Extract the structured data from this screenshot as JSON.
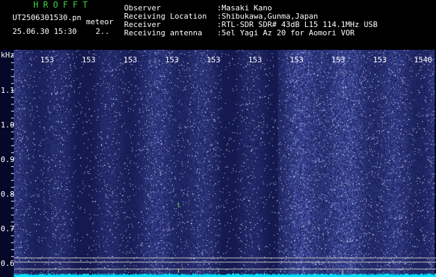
{
  "header": {
    "app_title": "HROFFT",
    "file_name": "UT2506301530.pn",
    "meteor_label": "meteor",
    "date_time": "25.06.30 15:30",
    "count_value": "2.."
  },
  "info": {
    "observer_key": "Observer",
    "observer_val": ":Masaki Kano",
    "location_key": "Receiving Location",
    "location_val": ":Shibukawa,Gunma,Japan",
    "receiver_key": "Receiver",
    "receiver_val": ":RTL-SDR SDR# 43dB L15 114.1MHz USB",
    "antenna_key": "Receiving antenna",
    "antenna_val": ":5el Yagi Az 20 for Aomori VOR"
  },
  "axis": {
    "y_unit": "kHz",
    "y_ticks": [
      "1.1",
      "1.0",
      "0.9",
      "0.8",
      "0.7",
      "0.6"
    ],
    "x_ticks": [
      "153",
      "153",
      "153",
      "153",
      "153",
      "153",
      "153",
      "153",
      "153",
      "1540"
    ]
  },
  "colors": {
    "background": "#000000",
    "signal_noise": "#1a2aa8",
    "baseline": "#00e0ff",
    "title_green": "#3cd63c"
  }
}
